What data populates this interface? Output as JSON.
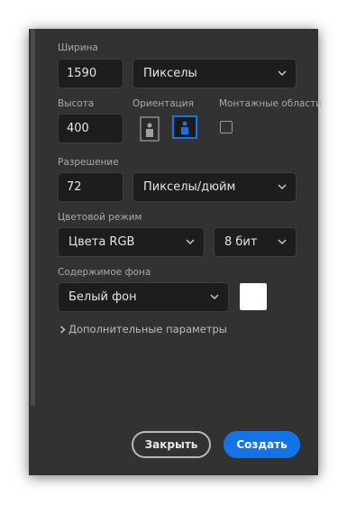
{
  "width": {
    "label": "Ширина",
    "value": "1590",
    "unit": "Пикселы"
  },
  "height": {
    "label": "Высота",
    "value": "400"
  },
  "orientation": {
    "label": "Ориентация",
    "portrait_icon": "portrait-orientation-icon",
    "landscape_icon": "landscape-orientation-icon",
    "selected": "landscape"
  },
  "artboards": {
    "label": "Монтажные области",
    "checked": false
  },
  "resolution": {
    "label": "Разрешение",
    "value": "72",
    "unit": "Пикселы/дюйм"
  },
  "color_mode": {
    "label": "Цветовой режим",
    "mode": "Цвета RGB",
    "depth": "8 бит"
  },
  "background": {
    "label": "Содержимое фона",
    "value": "Белый фон",
    "swatch_color": "#ffffff"
  },
  "advanced": {
    "label": "Дополнительные параметры",
    "icon": "chevron-right-icon"
  },
  "buttons": {
    "close": "Закрыть",
    "create": "Создать"
  },
  "colors": {
    "accent": "#1473e6",
    "panel": "#323232",
    "field": "#1d1d1d"
  }
}
